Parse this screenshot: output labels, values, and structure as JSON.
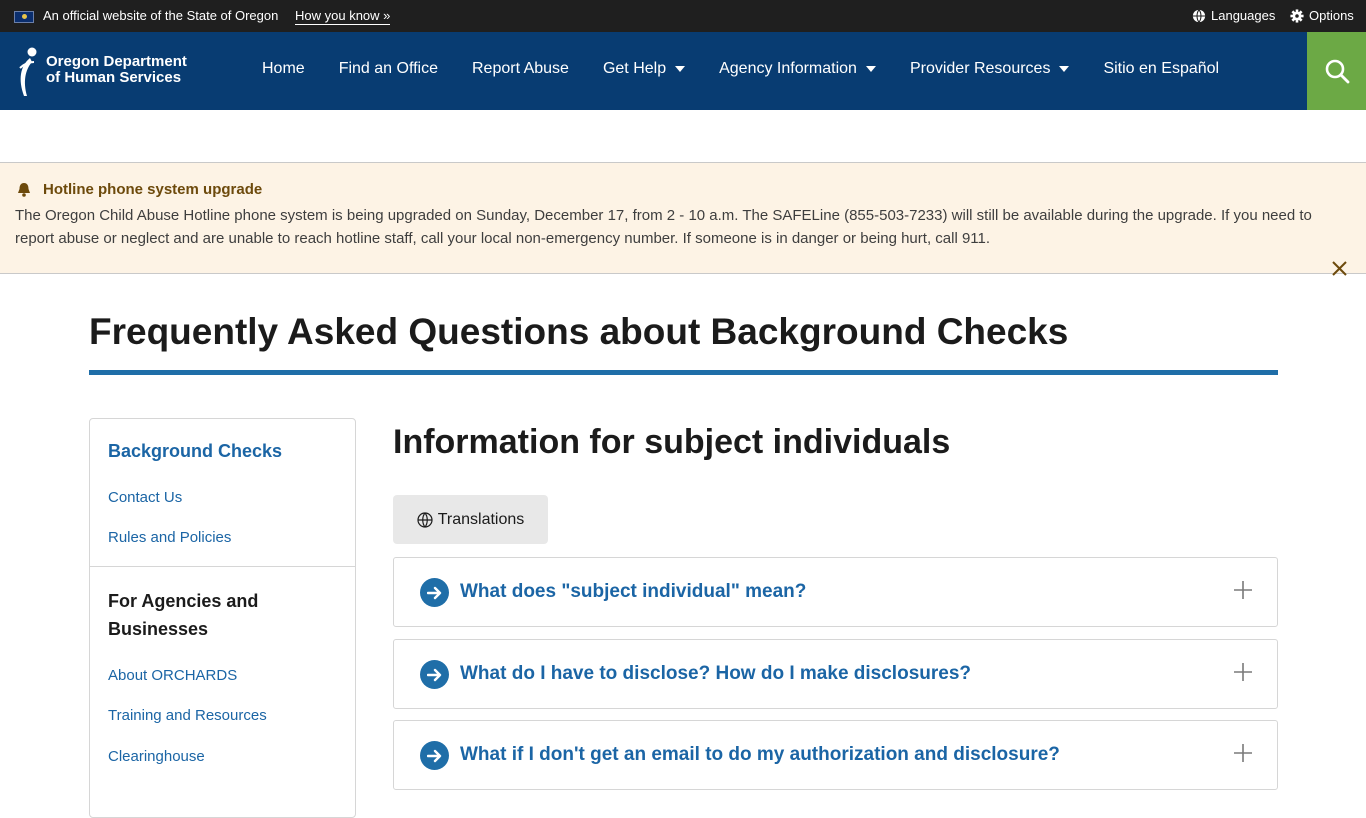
{
  "gov_bar": {
    "official_text": "An official website of the State of Oregon",
    "how_link": "How you know »",
    "languages": "Languages",
    "options": "Options"
  },
  "logo": {
    "line1": "Oregon Department",
    "line2": "of Human Services"
  },
  "nav": {
    "home": "Home",
    "find_office": "Find an Office",
    "report_abuse": "Report Abuse",
    "get_help": "Get Help",
    "agency_info": "Agency Information",
    "provider_resources": "Provider Resources",
    "spanish": "Sitio en Español"
  },
  "alert": {
    "title": "Hotline phone system upgrade",
    "body": "The Oregon Child Abuse Hotline phone system is being upgraded on Sunday, December 17, from 2 - 10 a.m. The SAFELine (855-503-7233) will still be available during the upgrade. If you need to report abuse or neglect and are unable to reach hotline staff, call your local non-emergency number. If someone is in danger or being hurt, call 911."
  },
  "page": {
    "title": "Frequently Asked Questions about Background Checks"
  },
  "sidebar": {
    "heading": "Background Checks",
    "links": [
      "Contact Us",
      "Rules and Policies"
    ],
    "subheading": "For Agencies and Businesses",
    "sub_links": [
      "About ORCHARDS",
      "Training and Resources",
      "Clearinghouse"
    ]
  },
  "main": {
    "heading": "Information for subject individuals",
    "translations": "Translations",
    "faqs": [
      "What does \"subject individual\" mean?",
      "What do I have to disclose? How do I make disclosures?",
      "What if I don't get an email to do my authorization and disclosure?"
    ]
  },
  "colors": {
    "nav_bg": "#083c72",
    "search_bg": "#6ca945",
    "accent_blue": "#1f6ea8",
    "link_blue": "#1b65a5",
    "alert_bg": "#fdf3e5"
  }
}
